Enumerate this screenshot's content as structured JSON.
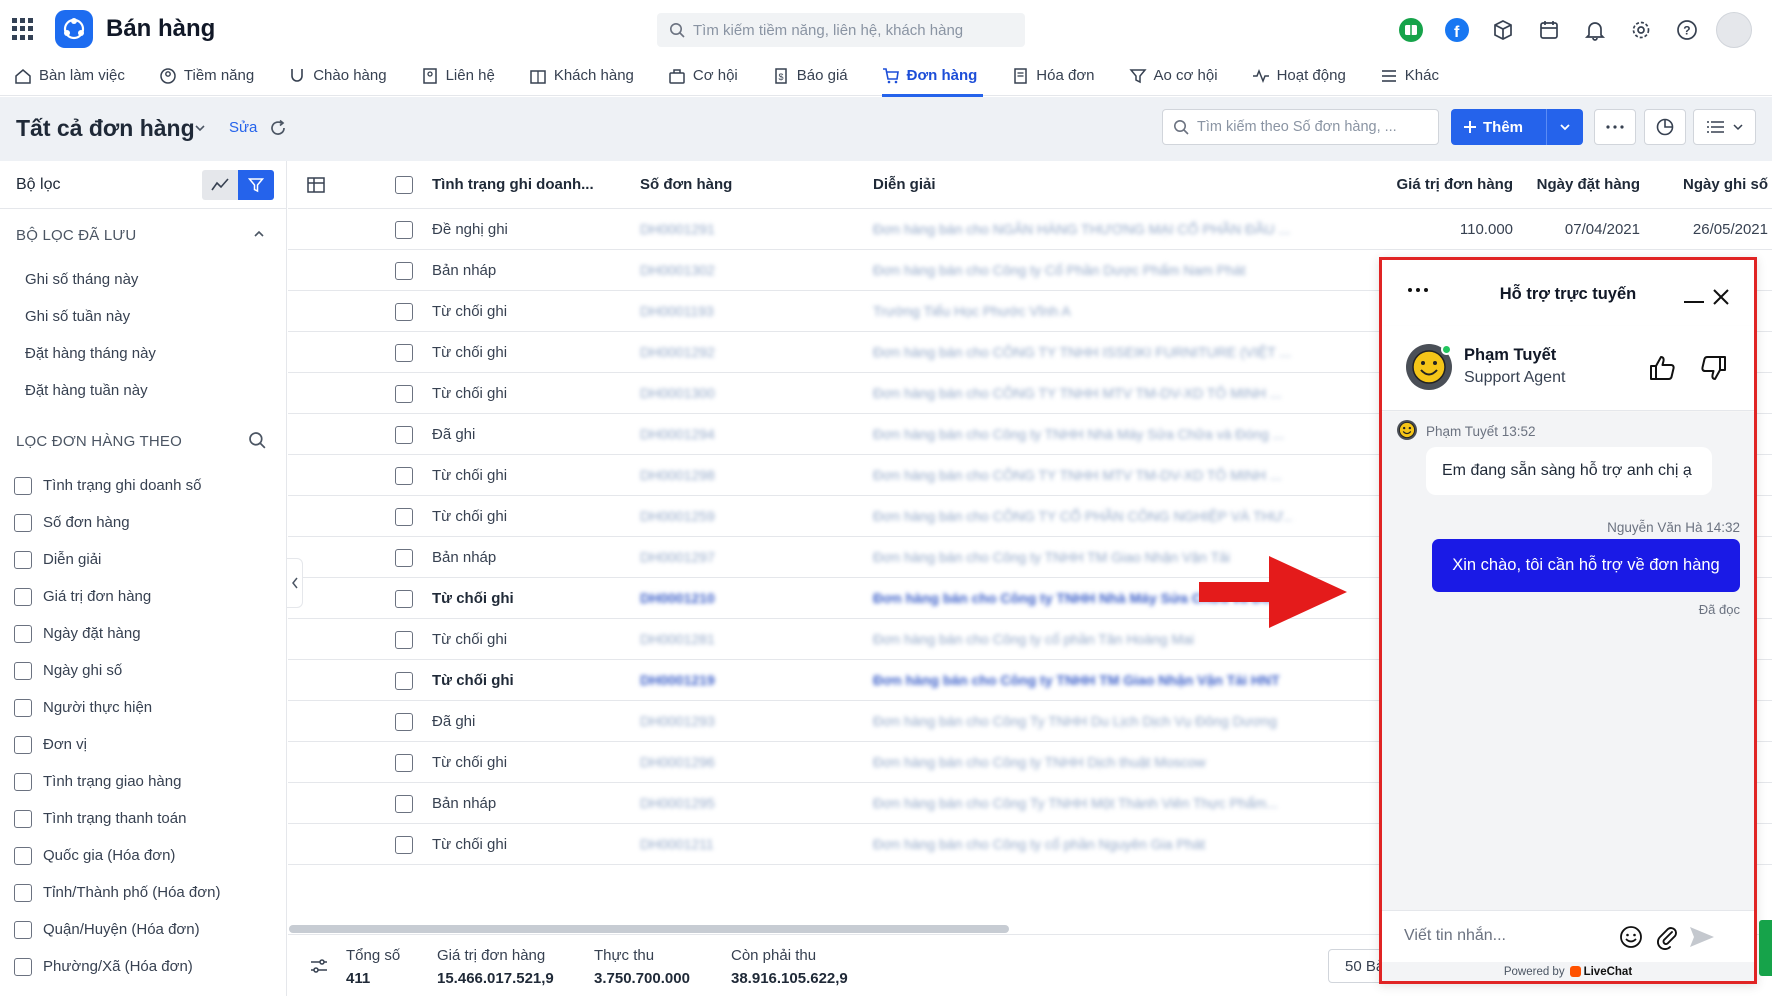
{
  "app": {
    "title": "Bán hàng"
  },
  "global_search": {
    "placeholder": "Tìm kiếm tiềm năng, liên hệ, khách hàng"
  },
  "nav": {
    "items": [
      {
        "label": "Bàn làm việc",
        "icon": "home-icon"
      },
      {
        "label": "Tiềm năng",
        "icon": "lead-icon"
      },
      {
        "label": "Chào hàng",
        "icon": "magnet-icon"
      },
      {
        "label": "Liên hệ",
        "icon": "contact-icon"
      },
      {
        "label": "Khách hàng",
        "icon": "building-icon"
      },
      {
        "label": "Cơ hội",
        "icon": "briefcase-icon"
      },
      {
        "label": "Báo giá",
        "icon": "quote-icon"
      },
      {
        "label": "Đơn hàng",
        "icon": "cart-icon"
      },
      {
        "label": "Hóa đơn",
        "icon": "invoice-icon"
      },
      {
        "label": "Ao cơ hội",
        "icon": "funnel-icon"
      },
      {
        "label": "Hoạt động",
        "icon": "activity-icon"
      },
      {
        "label": "Khác",
        "icon": "menu-icon"
      }
    ],
    "active_index": 7
  },
  "page": {
    "title": "Tất cả đơn hàng",
    "edit_label": "Sửa",
    "search_placeholder": "Tìm kiếm theo Số đơn hàng, ...",
    "add_label": "Thêm"
  },
  "sidebar": {
    "title": "Bộ lọc",
    "saved_section": "BỘ LỌC ĐÃ LƯU",
    "saved_filters": [
      "Ghi số tháng này",
      "Ghi số tuần này",
      "Đặt hàng tháng này",
      "Đặt hàng tuần này"
    ],
    "filter_section": "LỌC ĐƠN HÀNG THEO",
    "filters": [
      "Tình trạng ghi doanh số",
      "Số đơn hàng",
      "Diễn giải",
      "Giá trị đơn hàng",
      "Ngày đặt hàng",
      "Ngày ghi số",
      "Người thực hiện",
      "Đơn vị",
      "Tình trạng giao hàng",
      "Tình trạng thanh toán",
      "Quốc gia (Hóa đơn)",
      "Tỉnh/Thành phố (Hóa đơn)",
      "Quận/Huyện (Hóa đơn)",
      "Phường/Xã (Hóa đơn)"
    ]
  },
  "table": {
    "headers": {
      "status": "Tình trạng ghi doanh...",
      "number": "Số đơn hàng",
      "desc": "Diễn giải",
      "value": "Giá trị đơn hàng",
      "order_date": "Ngày đặt hàng",
      "record_date": "Ngày ghi số"
    },
    "rows": [
      {
        "status": "Đề nghị ghi",
        "number": "DH0001291",
        "desc": "Đơn hàng bán cho NGÂN HÀNG THƯƠNG MẠI CỔ PHẦN ĐẦU ...",
        "value": "110.000",
        "order_date": "07/04/2021",
        "record_date": "26/05/2021",
        "bold": false
      },
      {
        "status": "Bản nháp",
        "number": "DH0001302",
        "desc": "Đơn hàng bán cho Công ty Cổ Phần Dược Phẩm Nam Phát",
        "value": "",
        "order_date": "",
        "record_date": "",
        "bold": false
      },
      {
        "status": "Từ chối ghi",
        "number": "DH0001193",
        "desc": "Trường Tiểu Học Phước Vĩnh A",
        "value": "",
        "order_date": "",
        "record_date": "",
        "bold": false
      },
      {
        "status": "Từ chối ghi",
        "number": "DH0001292",
        "desc": "Đơn hàng bán cho CÔNG TY TNHH ISSEIKI FURNITURE (VIỆT ...",
        "value": "",
        "order_date": "",
        "record_date": "",
        "bold": false
      },
      {
        "status": "Từ chối ghi",
        "number": "DH0001300",
        "desc": "Đơn hàng bán cho CÔNG TY TNHH MTV TM-DV-XD TÔ MINH ...",
        "value": "",
        "order_date": "",
        "record_date": "",
        "bold": false
      },
      {
        "status": "Đã ghi",
        "number": "DH0001294",
        "desc": "Đơn hàng bán cho Công ty TNHH Nhà Máy Sửa Chữa và Đóng ...",
        "value": "",
        "order_date": "",
        "record_date": "",
        "bold": false
      },
      {
        "status": "Từ chối ghi",
        "number": "DH0001298",
        "desc": "Đơn hàng bán cho CÔNG TY TNHH MTV TM-DV-XD TÔ MINH ...",
        "value": "",
        "order_date": "",
        "record_date": "",
        "bold": false
      },
      {
        "status": "Từ chối ghi",
        "number": "DH0001259",
        "desc": "Đơn hàng bán cho CÔNG TY CỔ PHẦN CÔNG NGHIỆP VÀ THƯ...",
        "value": "",
        "order_date": "",
        "record_date": "",
        "bold": false
      },
      {
        "status": "Bản nháp",
        "number": "DH0001297",
        "desc": "Đơn hàng bán cho Công ty TNHH TM Giao Nhận Vận Tải",
        "value": "",
        "order_date": "",
        "record_date": "",
        "bold": false
      },
      {
        "status": "Từ chối ghi",
        "number": "DH0001210",
        "desc": "Đơn hàng bán cho Công ty TNHH Nhà Máy Sửa Chữa và Đóng...",
        "value": "",
        "order_date": "",
        "record_date": "",
        "bold": true
      },
      {
        "status": "Từ chối ghi",
        "number": "DH0001281",
        "desc": "Đơn hàng bán cho Công ty cổ phần Tân Hoàng Mai",
        "value": "",
        "order_date": "",
        "record_date": "",
        "bold": false
      },
      {
        "status": "Từ chối ghi",
        "number": "DH0001219",
        "desc": "Đơn hàng bán cho Công ty TNHH TM Giao Nhận Vận Tải HNT",
        "value": "",
        "order_date": "",
        "record_date": "",
        "bold": true
      },
      {
        "status": "Đã ghi",
        "number": "DH0001293",
        "desc": "Đơn hàng bán cho Công Ty TNHH Du Lịch Dịch Vụ Đông Dương",
        "value": "",
        "order_date": "",
        "record_date": "",
        "bold": false
      },
      {
        "status": "Từ chối ghi",
        "number": "DH0001296",
        "desc": "Đơn hàng bán cho Công ty TNHH Dịch thuật Moscow",
        "value": "",
        "order_date": "",
        "record_date": "",
        "bold": false
      },
      {
        "status": "Bản nháp",
        "number": "DH0001295",
        "desc": "Đơn hàng bán cho Công Ty TNHH Một Thành Viên Thực Phẩm...",
        "value": "",
        "order_date": "",
        "record_date": "",
        "bold": false
      },
      {
        "status": "Từ chối ghi",
        "number": "DH0001211",
        "desc": "Đơn hàng bán cho Công ty cổ phần Nguyên Gia Phát",
        "value": "",
        "order_date": "",
        "record_date": "",
        "bold": false
      }
    ]
  },
  "footer": {
    "total_label": "Tổng số",
    "total_value": "411",
    "order_value_label": "Giá trị đơn hàng",
    "order_value": "15.466.017.521,9",
    "received_label": "Thực thu",
    "received_value": "3.750.700.000",
    "remaining_label": "Còn phải thu",
    "remaining_value": "38.916.105.622,9",
    "page_size": "50 Bả"
  },
  "chat": {
    "title": "Hỗ trợ trực tuyến",
    "agent_name": "Phạm Tuyết",
    "agent_role": "Support Agent",
    "messages": [
      {
        "meta": "Phạm Tuyết 13:52",
        "text": "Em đang sẵn sàng hỗ trợ anh chị ạ"
      },
      {
        "meta": "Nguyễn Văn Hà 14:32",
        "text": "Xin chào, tôi cần hỗ trợ về đơn hàng"
      }
    ],
    "read_status": "Đã đọc",
    "input_placeholder": "Viết tin nhắn...",
    "powered_by": "Powered by",
    "brand": "LiveChat"
  },
  "colors": {
    "accent": "#2563eb",
    "highlight_border": "#e02424",
    "outgoing_bubble": "#1a1ae6",
    "arrow": "#e41b1b"
  }
}
